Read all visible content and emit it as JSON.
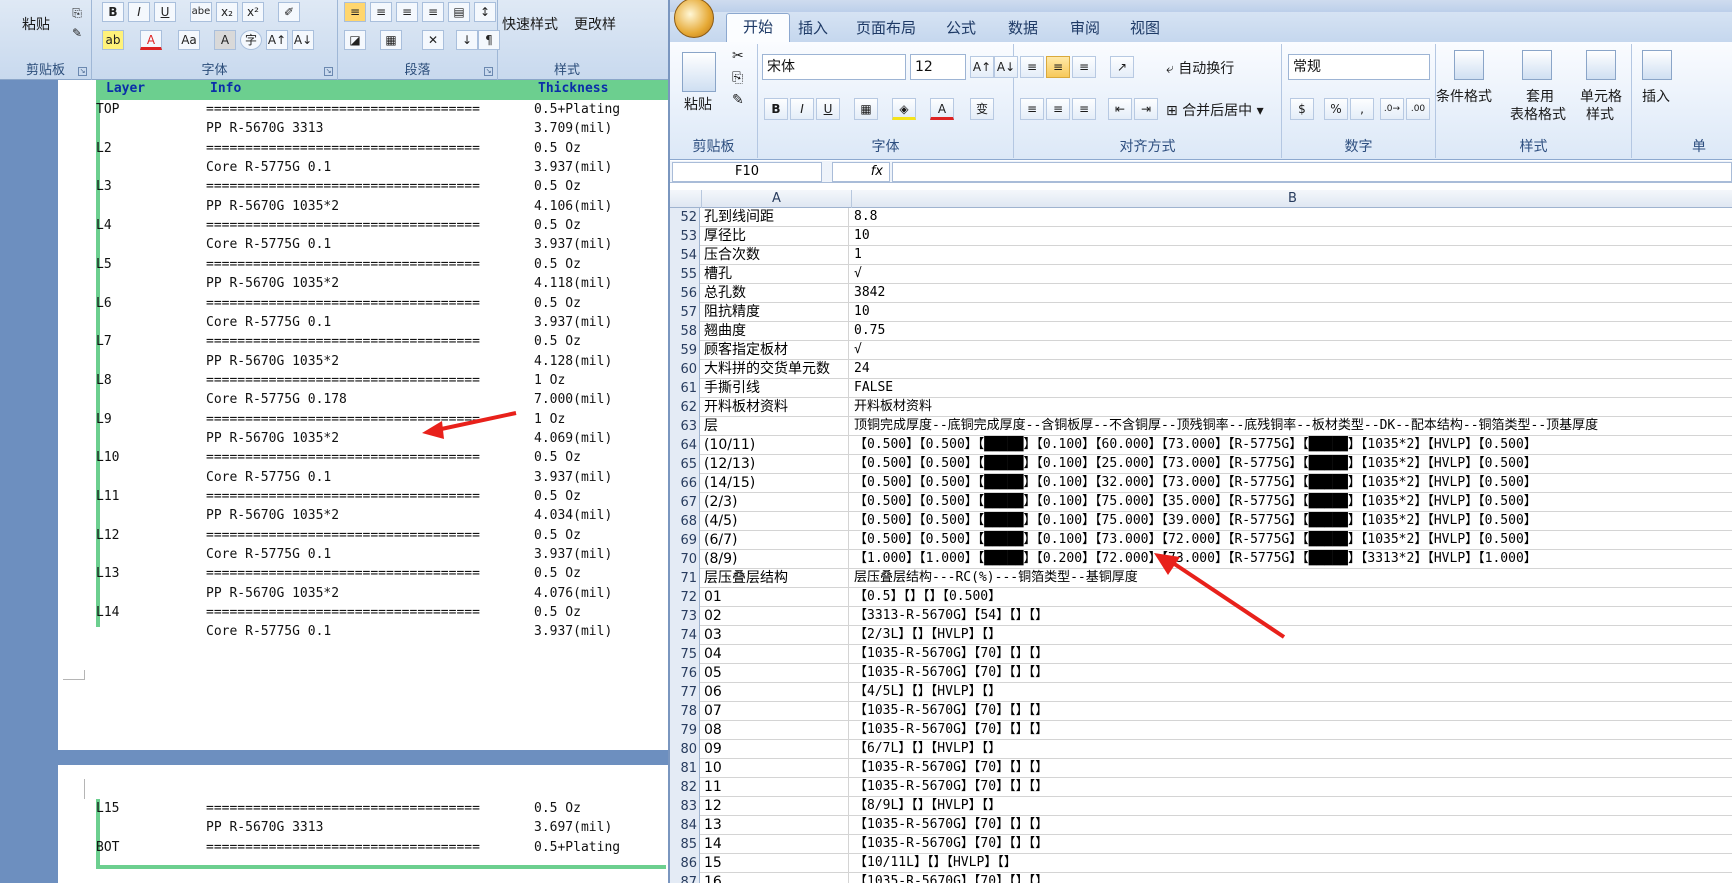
{
  "word": {
    "ribbon": {
      "paste_label": "粘贴",
      "clipboard_group": "剪贴板",
      "font_group": "字体",
      "paragraph_group": "段落",
      "styles_group": "样式",
      "quick_styles": "快速样式",
      "change_styles": "更改样",
      "font_buttons": [
        "B",
        "I",
        "U",
        "abe",
        "x₂",
        "x²",
        "Aa",
        "A",
        "A↑",
        "A↓"
      ]
    },
    "table": {
      "headers": [
        "Layer",
        "Info",
        "Thickness"
      ],
      "rows": [
        [
          "TOP",
          "===================================",
          "0.5+Plating"
        ],
        [
          "",
          "PP    R-5670G    3313",
          "3.709(mil)"
        ],
        [
          "L2",
          "===================================",
          "0.5 Oz"
        ],
        [
          "",
          "Core    R-5775G    0.1",
          "3.937(mil)"
        ],
        [
          "L3",
          "===================================",
          "0.5 Oz"
        ],
        [
          "",
          "PP    R-5670G    1035*2",
          "4.106(mil)"
        ],
        [
          "L4",
          "===================================",
          "0.5 Oz"
        ],
        [
          "",
          "Core    R-5775G    0.1",
          "3.937(mil)"
        ],
        [
          "L5",
          "===================================",
          "0.5 Oz"
        ],
        [
          "",
          "PP    R-5670G    1035*2",
          "4.118(mil)"
        ],
        [
          "L6",
          "===================================",
          "0.5 Oz"
        ],
        [
          "",
          "Core    R-5775G    0.1",
          "3.937(mil)"
        ],
        [
          "L7",
          "===================================",
          "0.5 Oz"
        ],
        [
          "",
          "PP    R-5670G    1035*2",
          "4.128(mil)"
        ],
        [
          "L8",
          "===================================",
          "1 Oz"
        ],
        [
          "",
          "Core    R-5775G    0.178",
          "7.000(mil)"
        ],
        [
          "L9",
          "===================================",
          "1 Oz"
        ],
        [
          "",
          "PP    R-5670G    1035*2",
          "4.069(mil)"
        ],
        [
          "L10",
          "===================================",
          "0.5 Oz"
        ],
        [
          "",
          "Core    R-5775G    0.1",
          "3.937(mil)"
        ],
        [
          "L11",
          "===================================",
          "0.5 Oz"
        ],
        [
          "",
          "PP    R-5670G    1035*2",
          "4.034(mil)"
        ],
        [
          "L12",
          "===================================",
          "0.5 Oz"
        ],
        [
          "",
          "Core    R-5775G    0.1",
          "3.937(mil)"
        ],
        [
          "L13",
          "===================================",
          "0.5 Oz"
        ],
        [
          "",
          "PP    R-5670G    1035*2",
          "4.076(mil)"
        ],
        [
          "L14",
          "===================================",
          "0.5 Oz"
        ],
        [
          "",
          "Core    R-5775G    0.1",
          "3.937(mil)"
        ]
      ],
      "rows_page2": [
        [
          "L15",
          "===================================",
          "0.5 Oz"
        ],
        [
          "",
          "PP    R-5670G    3313",
          "3.697(mil)"
        ],
        [
          "BOT",
          "===================================",
          "0.5+Plating"
        ]
      ]
    }
  },
  "excel": {
    "tabs": [
      "开始",
      "插入",
      "页面布局",
      "公式",
      "数据",
      "审阅",
      "视图"
    ],
    "ribbon": {
      "paste": "粘贴",
      "clipboard_group": "剪贴板",
      "font_name": "宋体",
      "font_size": "12",
      "font_group": "字体",
      "wrap_text": "自动换行",
      "merge_center": "合并后居中",
      "alignment_group": "对齐方式",
      "number_format": "常规",
      "number_group": "数字",
      "conditional_format": "条件格式",
      "table_format_1": "套用",
      "table_format_2": "表格格式",
      "cell_style_1": "单元格",
      "cell_style_2": "样式",
      "styles_group": "样式",
      "insert": "插入",
      "cells_group_partial": "单"
    },
    "name_box": "F10",
    "fx_label": "fx",
    "columns": [
      "A",
      "B"
    ],
    "rows": [
      [
        "52",
        "孔到线间距",
        "8.8"
      ],
      [
        "53",
        "厚径比",
        "10"
      ],
      [
        "54",
        "压合次数",
        "1"
      ],
      [
        "55",
        "槽孔",
        "√"
      ],
      [
        "56",
        "总孔数",
        "3842"
      ],
      [
        "57",
        "阻抗精度",
        "10"
      ],
      [
        "58",
        "翘曲度",
        "0.75"
      ],
      [
        "59",
        "顾客指定板材",
        "√"
      ],
      [
        "60",
        "大料拼的交货单元数",
        "24"
      ],
      [
        "61",
        "手撕引线",
        "FALSE"
      ],
      [
        "62",
        "开料板材资料",
        "开料板材资料"
      ],
      [
        "63",
        "层",
        "顶铜完成厚度--底铜完成厚度--含铜板厚--不含铜厚--顶残铜率--底残铜率--板材类型--DK--配本结构--铜箔类型--顶基厚度"
      ],
      [
        "64",
        "(10/11)",
        "【0.500】【0.500】【█████】【0.100】【60.000】【73.000】【R-5775G】【█████】【1035*2】【HVLP】【0.500】"
      ],
      [
        "65",
        "(12/13)",
        "【0.500】【0.500】【█████】【0.100】【25.000】【73.000】【R-5775G】【█████】【1035*2】【HVLP】【0.500】"
      ],
      [
        "66",
        "(14/15)",
        "【0.500】【0.500】【█████】【0.100】【32.000】【73.000】【R-5775G】【█████】【1035*2】【HVLP】【0.500】"
      ],
      [
        "67",
        "(2/3)",
        "【0.500】【0.500】【█████】【0.100】【75.000】【35.000】【R-5775G】【█████】【1035*2】【HVLP】【0.500】"
      ],
      [
        "68",
        "(4/5)",
        "【0.500】【0.500】【█████】【0.100】【75.000】【39.000】【R-5775G】【█████】【1035*2】【HVLP】【0.500】"
      ],
      [
        "69",
        "(6/7)",
        "【0.500】【0.500】【█████】【0.100】【73.000】【72.000】【R-5775G】【█████】【1035*2】【HVLP】【0.500】"
      ],
      [
        "70",
        "(8/9)",
        "【1.000】【1.000】【█████】【0.200】【72.000】【73.000】【R-5775G】【█████】【3313*2】【HVLP】【1.000】"
      ],
      [
        "71",
        "层压叠层结构",
        "层压叠层结构---RC(%)---铜箔类型--基铜厚度"
      ],
      [
        "72",
        "01",
        "【0.5】【】【】【0.500】"
      ],
      [
        "73",
        "02",
        "【3313-R-5670G】【54】【】【】"
      ],
      [
        "74",
        "03",
        "【2/3L】【】【HVLP】【】"
      ],
      [
        "75",
        "04",
        "【1035-R-5670G】【70】【】【】"
      ],
      [
        "76",
        "05",
        "【1035-R-5670G】【70】【】【】"
      ],
      [
        "77",
        "06",
        "【4/5L】【】【HVLP】【】"
      ],
      [
        "78",
        "07",
        "【1035-R-5670G】【70】【】【】"
      ],
      [
        "79",
        "08",
        "【1035-R-5670G】【70】【】【】"
      ],
      [
        "80",
        "09",
        "【6/7L】【】【HVLP】【】"
      ],
      [
        "81",
        "10",
        "【1035-R-5670G】【70】【】【】"
      ],
      [
        "82",
        "11",
        "【1035-R-5670G】【70】【】【】"
      ],
      [
        "83",
        "12",
        "【8/9L】【】【HVLP】【】"
      ],
      [
        "84",
        "13",
        "【1035-R-5670G】【70】【】【】"
      ],
      [
        "85",
        "14",
        "【1035-R-5670G】【70】【】【】"
      ],
      [
        "86",
        "15",
        "【10/11L】【】【HVLP】【】"
      ],
      [
        "87",
        "16",
        "【1035-R-5670G】【70】【】【】"
      ]
    ]
  },
  "colors": {
    "table_header": "#6ccf8f",
    "header_text": "#0a2ea8",
    "arrow": "#e8211b"
  }
}
